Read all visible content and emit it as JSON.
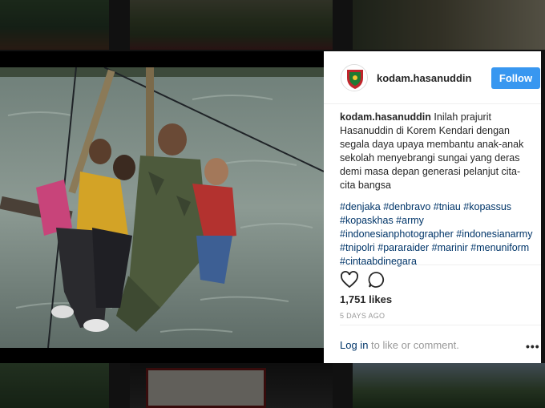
{
  "post": {
    "username": "kodam.hasanuddin",
    "follow_label": "Follow",
    "caption_username": "kodam.hasanuddin",
    "caption_text": "Inilah prajurit Hasanuddin di Korem Kendari dengan segala daya upaya membantu anak-anak sekolah menyebrangi sungai yang deras demi masa depan generasi pelanjut cita-cita bangsa",
    "hashtags": "#denjaka #denbravo #tniau #kopassus #kopaskhas #army #indonesianphotographer #indonesianarmy #tnipolri #pararaider #marinir #menuniform #cintaabdinegara",
    "likes": "1,751 likes",
    "time": "5 DAYS AGO",
    "login_link": "Log in",
    "login_rest": " to like or comment.",
    "more": "•••"
  },
  "icons": {
    "like": "heart-outline-icon",
    "comment": "comment-bubble-icon",
    "more": "more-options-icon"
  },
  "colors": {
    "follow_button": "#3897f0",
    "hashtag": "#003569",
    "avatar_badge": "#c0262c"
  }
}
